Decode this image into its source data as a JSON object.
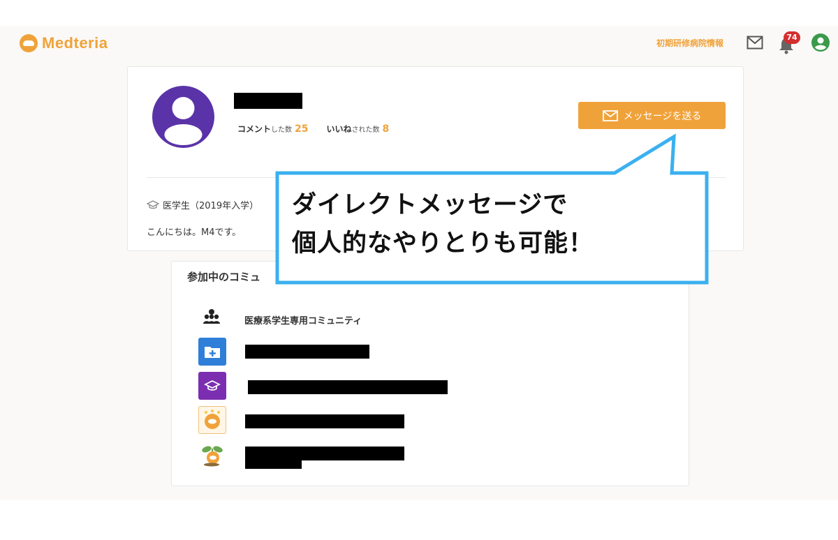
{
  "header": {
    "logo_text": "Medteria",
    "nav_link": "初期研修病院情報",
    "notification_count": "74"
  },
  "profile": {
    "comment_label": "コメント",
    "comment_suffix": "した数",
    "comment_count": "25",
    "like_label": "いいね",
    "like_suffix": "された数",
    "like_count": "8",
    "message_button": "メッセージを送る",
    "affiliation": "医学生（2019年入学）",
    "greeting": "こんにちは。M4です。"
  },
  "communities": {
    "heading": "参加中のコミュ",
    "items": [
      {
        "name": "医療系学生専用コミュニティ",
        "icon": "community-people-icon"
      },
      {
        "name": "",
        "icon": "medical-folder-icon",
        "color": "#2f7fd9"
      },
      {
        "name": "",
        "icon": "graduation-cap-icon",
        "color": "#7b2fb0"
      },
      {
        "name": "",
        "icon": "medteria-badge-icon",
        "color": "#f0a23a"
      },
      {
        "name": "",
        "icon": "sprout-icon",
        "color": "#f0a23a"
      }
    ]
  },
  "callout": {
    "line1": "ダイレクトメッセージで",
    "line2": "個人的なやりとりも可能！",
    "border_color": "#3ab0ef"
  },
  "colors": {
    "accent": "#f0a23a",
    "avatar_purple": "#5b33a8",
    "badge_red": "#d32f2f",
    "user_icon_green": "#3a9a4a"
  }
}
